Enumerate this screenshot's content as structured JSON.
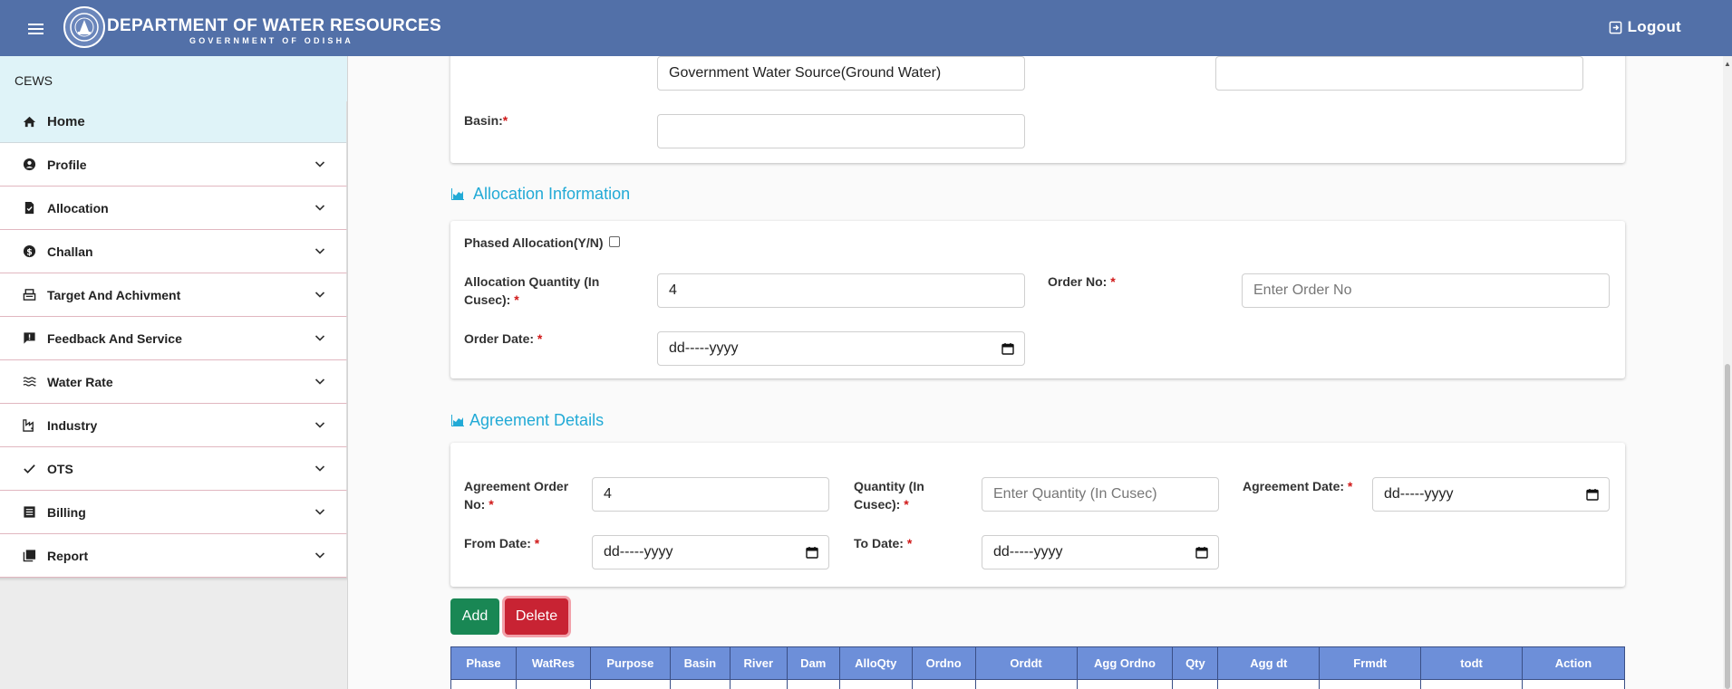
{
  "header": {
    "title": "DEPARTMENT OF WATER RESOURCES",
    "subtitle": "GOVERNMENT OF ODISHA",
    "logout_label": "Logout",
    "menu_icon": "hamburger-icon",
    "logo_icon": "emblem-logo"
  },
  "sidebar": {
    "heading": "CEWS",
    "home_label": "Home",
    "items": [
      {
        "label": "Profile",
        "icon": "user-circle-icon"
      },
      {
        "label": "Allocation",
        "icon": "document-check-icon"
      },
      {
        "label": "Challan",
        "icon": "dollar-circle-icon"
      },
      {
        "label": "Target And Achivment",
        "icon": "cash-register-icon"
      },
      {
        "label": "Feedback And Service",
        "icon": "feedback-icon"
      },
      {
        "label": "Water Rate",
        "icon": "water-icon"
      },
      {
        "label": "Industry",
        "icon": "industry-icon"
      },
      {
        "label": "OTS",
        "icon": "check-icon"
      },
      {
        "label": "Billing",
        "icon": "list-icon"
      },
      {
        "label": "Report",
        "icon": "report-icon"
      }
    ]
  },
  "source_card": {
    "source_value": "Government Water Source(Ground Water)",
    "basin_label": "Basin:",
    "basin_value": ""
  },
  "allocation": {
    "section_title": "Allocation Information",
    "phased_label": "Phased Allocation(Y/N)",
    "qty_label_1": "Allocation Quantity (In",
    "qty_label_2": "Cusec):",
    "qty_value": "4",
    "order_no_label": "Order No:",
    "order_no_placeholder": "Enter Order No",
    "order_date_label": "Order Date:",
    "order_date_value": "dd-----yyyy"
  },
  "agreement": {
    "section_title": "Agreement Details",
    "order_no_label_1": "Agreement Order",
    "order_no_label_2": "No:",
    "order_no_value": "4",
    "qty_label_1": "Quantity (In",
    "qty_label_2": "Cusec):",
    "qty_placeholder": "Enter Quantity (In Cusec)",
    "date_label": "Agreement Date:",
    "date_value": "dd-----yyyy",
    "from_label": "From Date:",
    "from_value": "dd-----yyyy",
    "to_label": "To Date:",
    "to_value": "dd-----yyyy"
  },
  "buttons": {
    "add": "Add",
    "delete": "Delete"
  },
  "table": {
    "columns": [
      "Phase",
      "WatRes",
      "Purpose",
      "Basin",
      "River",
      "Dam",
      "AlloQty",
      "Ordno",
      "Orddt",
      "Agg Ordno",
      "Qty",
      "Agg dt",
      "Frmdt",
      "todt",
      "Action"
    ]
  },
  "colors": {
    "header_bg": "#5270a8",
    "accent": "#22aad6",
    "add": "#198754",
    "delete": "#c82333",
    "table_header": "#6d8fd9"
  }
}
